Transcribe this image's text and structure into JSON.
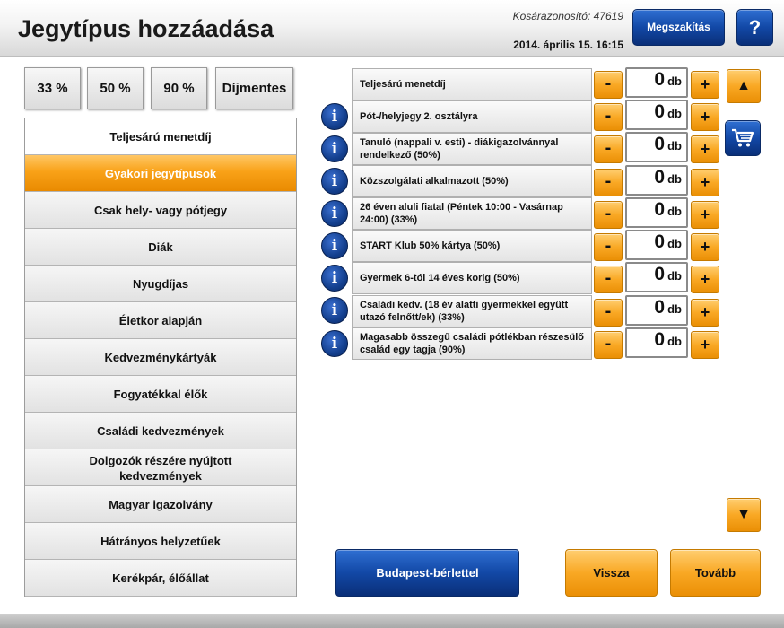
{
  "header": {
    "title": "Jegytípus hozzáadása",
    "cart_id": "Kosárazonosító: 47619",
    "datetime": "2014. április 15.   16:15",
    "abort_label": "Megszakítás",
    "help_label": "?"
  },
  "discount_filters": [
    "33 %",
    "50 %",
    "90 %",
    "Díjmentes"
  ],
  "categories": [
    {
      "label": "Teljesárú menetdíj"
    },
    {
      "label": "Gyakori jegytípusok"
    },
    {
      "label": "Csak hely- vagy pótjegy"
    },
    {
      "label": "Diák"
    },
    {
      "label": "Nyugdíjas"
    },
    {
      "label": "Életkor alapján"
    },
    {
      "label": "Kedvezménykártyák"
    },
    {
      "label": "Fogyatékkal élők"
    },
    {
      "label": "Családi kedvezmények"
    },
    {
      "label": "Dolgozók részére nyújtott kedvezmények"
    },
    {
      "label": "Magyar igazolvány"
    },
    {
      "label": "Hátrányos helyzetűek"
    },
    {
      "label": "Kerékpár, élőállat"
    }
  ],
  "active_category": "Gyakori jegytípusok",
  "tickets": [
    {
      "label": "Teljesárú menetdíj",
      "qty": "0",
      "unit": "db",
      "info": false
    },
    {
      "label": "Pót-/helyjegy 2. osztályra",
      "qty": "0",
      "unit": "db",
      "info": true
    },
    {
      "label": "Tanuló (nappali v. esti) - diákigazolvánnyal rendelkező (50%)",
      "qty": "0",
      "unit": "db",
      "info": true
    },
    {
      "label": "Közszolgálati alkalmazott (50%)",
      "qty": "0",
      "unit": "db",
      "info": true
    },
    {
      "label": "26 éven aluli fiatal (Péntek 10:00 - Vasárnap 24:00) (33%)",
      "qty": "0",
      "unit": "db",
      "info": true
    },
    {
      "label": "START Klub 50% kártya (50%)",
      "qty": "0",
      "unit": "db",
      "info": true
    },
    {
      "label": "Gyermek 6-tól 14 éves korig (50%)",
      "qty": "0",
      "unit": "db",
      "info": true
    },
    {
      "label": "Családi kedv. (18 év alatti gyermekkel együtt utazó felnőtt/ek) (33%)",
      "qty": "0",
      "unit": "db",
      "info": true
    },
    {
      "label": "Magasabb összegű családi pótlékban részesülő család egy tagja (90%)",
      "qty": "0",
      "unit": "db",
      "info": true
    }
  ],
  "controls": {
    "minus": "-",
    "plus": "+",
    "info": "i",
    "scroll_up": "▲",
    "scroll_down": "▼"
  },
  "footer": {
    "budapest_label": "Budapest-bérlettel",
    "back_label": "Vissza",
    "next_label": "Tovább"
  },
  "colors": {
    "accent_orange": "#f9a218",
    "accent_blue": "#1248a6"
  }
}
